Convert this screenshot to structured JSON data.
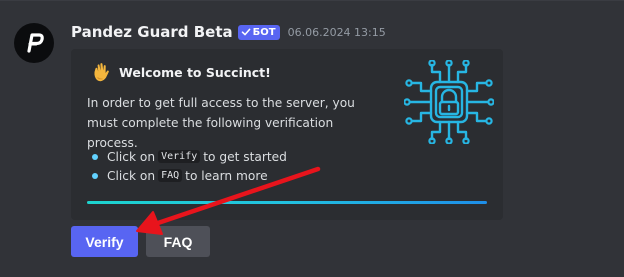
{
  "message": {
    "author": "Pandez Guard Beta",
    "bot_badge": "БОТ",
    "timestamp": "06.06.2024 13:15",
    "avatar_icon": "pandez-logo-icon"
  },
  "embed": {
    "title_icon": "waving-hand-icon",
    "title": "Welcome to Succinct!",
    "description": "In order to get full access to the server, you must complete the following verification process.",
    "list": [
      {
        "prefix": "Click on",
        "code": "Verify",
        "suffix": "to get started"
      },
      {
        "prefix": "Click on",
        "code": "FAQ",
        "suffix": "to learn more"
      }
    ],
    "thumbnail_icon": "circuit-padlock-icon",
    "progress": 1.0,
    "accent_colors": [
      "#1dd4cf",
      "#1e8ee8"
    ]
  },
  "buttons": {
    "verify_label": "Verify",
    "faq_label": "FAQ"
  },
  "colors": {
    "background": "#313338",
    "embed_background": "#2b2d31",
    "blurple": "#5865f2",
    "secondary_button": "#4e5058",
    "annotation_arrow": "#e8141c"
  }
}
